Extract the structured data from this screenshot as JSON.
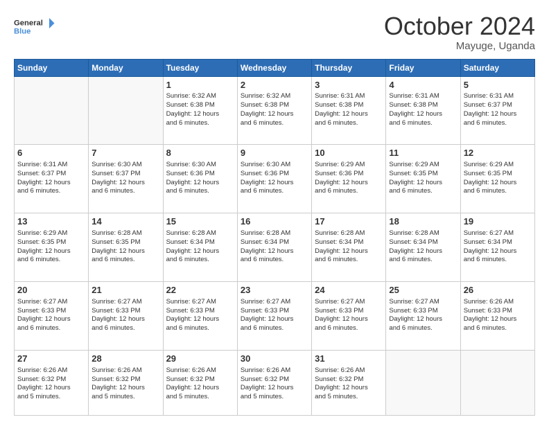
{
  "logo": {
    "line1": "General",
    "line2": "Blue"
  },
  "title": "October 2024",
  "location": "Mayuge, Uganda",
  "days_of_week": [
    "Sunday",
    "Monday",
    "Tuesday",
    "Wednesday",
    "Thursday",
    "Friday",
    "Saturday"
  ],
  "weeks": [
    [
      {
        "day": "",
        "info": ""
      },
      {
        "day": "",
        "info": ""
      },
      {
        "day": "1",
        "info": "Sunrise: 6:32 AM\nSunset: 6:38 PM\nDaylight: 12 hours\nand 6 minutes."
      },
      {
        "day": "2",
        "info": "Sunrise: 6:32 AM\nSunset: 6:38 PM\nDaylight: 12 hours\nand 6 minutes."
      },
      {
        "day": "3",
        "info": "Sunrise: 6:31 AM\nSunset: 6:38 PM\nDaylight: 12 hours\nand 6 minutes."
      },
      {
        "day": "4",
        "info": "Sunrise: 6:31 AM\nSunset: 6:38 PM\nDaylight: 12 hours\nand 6 minutes."
      },
      {
        "day": "5",
        "info": "Sunrise: 6:31 AM\nSunset: 6:37 PM\nDaylight: 12 hours\nand 6 minutes."
      }
    ],
    [
      {
        "day": "6",
        "info": "Sunrise: 6:31 AM\nSunset: 6:37 PM\nDaylight: 12 hours\nand 6 minutes."
      },
      {
        "day": "7",
        "info": "Sunrise: 6:30 AM\nSunset: 6:37 PM\nDaylight: 12 hours\nand 6 minutes."
      },
      {
        "day": "8",
        "info": "Sunrise: 6:30 AM\nSunset: 6:36 PM\nDaylight: 12 hours\nand 6 minutes."
      },
      {
        "day": "9",
        "info": "Sunrise: 6:30 AM\nSunset: 6:36 PM\nDaylight: 12 hours\nand 6 minutes."
      },
      {
        "day": "10",
        "info": "Sunrise: 6:29 AM\nSunset: 6:36 PM\nDaylight: 12 hours\nand 6 minutes."
      },
      {
        "day": "11",
        "info": "Sunrise: 6:29 AM\nSunset: 6:35 PM\nDaylight: 12 hours\nand 6 minutes."
      },
      {
        "day": "12",
        "info": "Sunrise: 6:29 AM\nSunset: 6:35 PM\nDaylight: 12 hours\nand 6 minutes."
      }
    ],
    [
      {
        "day": "13",
        "info": "Sunrise: 6:29 AM\nSunset: 6:35 PM\nDaylight: 12 hours\nand 6 minutes."
      },
      {
        "day": "14",
        "info": "Sunrise: 6:28 AM\nSunset: 6:35 PM\nDaylight: 12 hours\nand 6 minutes."
      },
      {
        "day": "15",
        "info": "Sunrise: 6:28 AM\nSunset: 6:34 PM\nDaylight: 12 hours\nand 6 minutes."
      },
      {
        "day": "16",
        "info": "Sunrise: 6:28 AM\nSunset: 6:34 PM\nDaylight: 12 hours\nand 6 minutes."
      },
      {
        "day": "17",
        "info": "Sunrise: 6:28 AM\nSunset: 6:34 PM\nDaylight: 12 hours\nand 6 minutes."
      },
      {
        "day": "18",
        "info": "Sunrise: 6:28 AM\nSunset: 6:34 PM\nDaylight: 12 hours\nand 6 minutes."
      },
      {
        "day": "19",
        "info": "Sunrise: 6:27 AM\nSunset: 6:34 PM\nDaylight: 12 hours\nand 6 minutes."
      }
    ],
    [
      {
        "day": "20",
        "info": "Sunrise: 6:27 AM\nSunset: 6:33 PM\nDaylight: 12 hours\nand 6 minutes."
      },
      {
        "day": "21",
        "info": "Sunrise: 6:27 AM\nSunset: 6:33 PM\nDaylight: 12 hours\nand 6 minutes."
      },
      {
        "day": "22",
        "info": "Sunrise: 6:27 AM\nSunset: 6:33 PM\nDaylight: 12 hours\nand 6 minutes."
      },
      {
        "day": "23",
        "info": "Sunrise: 6:27 AM\nSunset: 6:33 PM\nDaylight: 12 hours\nand 6 minutes."
      },
      {
        "day": "24",
        "info": "Sunrise: 6:27 AM\nSunset: 6:33 PM\nDaylight: 12 hours\nand 6 minutes."
      },
      {
        "day": "25",
        "info": "Sunrise: 6:27 AM\nSunset: 6:33 PM\nDaylight: 12 hours\nand 6 minutes."
      },
      {
        "day": "26",
        "info": "Sunrise: 6:26 AM\nSunset: 6:33 PM\nDaylight: 12 hours\nand 6 minutes."
      }
    ],
    [
      {
        "day": "27",
        "info": "Sunrise: 6:26 AM\nSunset: 6:32 PM\nDaylight: 12 hours\nand 5 minutes."
      },
      {
        "day": "28",
        "info": "Sunrise: 6:26 AM\nSunset: 6:32 PM\nDaylight: 12 hours\nand 5 minutes."
      },
      {
        "day": "29",
        "info": "Sunrise: 6:26 AM\nSunset: 6:32 PM\nDaylight: 12 hours\nand 5 minutes."
      },
      {
        "day": "30",
        "info": "Sunrise: 6:26 AM\nSunset: 6:32 PM\nDaylight: 12 hours\nand 5 minutes."
      },
      {
        "day": "31",
        "info": "Sunrise: 6:26 AM\nSunset: 6:32 PM\nDaylight: 12 hours\nand 5 minutes."
      },
      {
        "day": "",
        "info": ""
      },
      {
        "day": "",
        "info": ""
      }
    ]
  ]
}
